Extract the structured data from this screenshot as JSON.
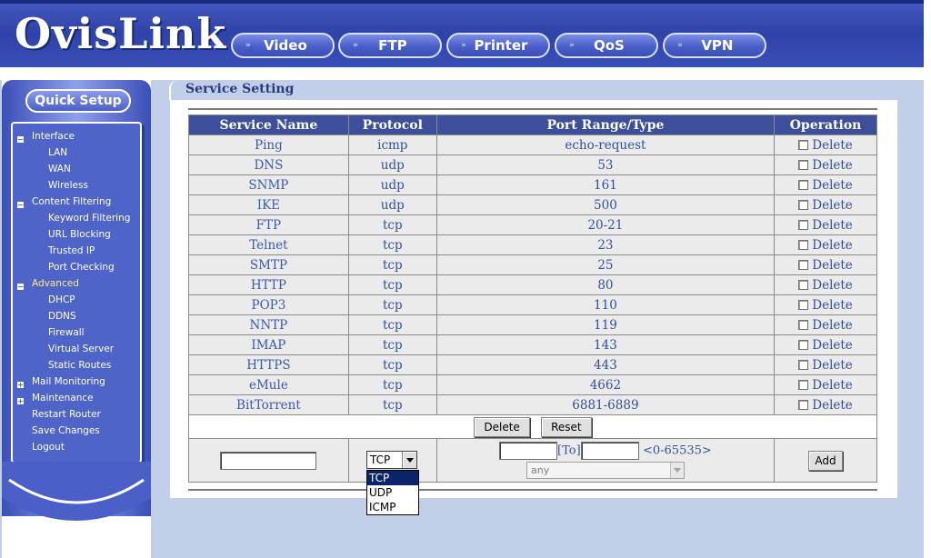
{
  "header": {
    "logo": "OvisLink",
    "nav": [
      {
        "label": "Video"
      },
      {
        "label": "FTP"
      },
      {
        "label": "Printer"
      },
      {
        "label": "QoS"
      },
      {
        "label": "VPN"
      }
    ],
    "nav_arrow": "»"
  },
  "sidebar": {
    "quick_setup": "Quick Setup",
    "menu": [
      {
        "label": "Interface",
        "level": "top",
        "expander": "−"
      },
      {
        "label": "LAN",
        "level": "sub"
      },
      {
        "label": "WAN",
        "level": "sub"
      },
      {
        "label": "Wireless",
        "level": "sub"
      },
      {
        "label": "Content Filtering",
        "level": "top",
        "expander": "−"
      },
      {
        "label": "Keyword Filtering",
        "level": "sub"
      },
      {
        "label": "URL Blocking",
        "level": "sub"
      },
      {
        "label": "Trusted IP",
        "level": "sub"
      },
      {
        "label": "Port Checking",
        "level": "sub"
      },
      {
        "label": "Advanced",
        "level": "top",
        "expander": "−",
        "active": true
      },
      {
        "label": "DHCP",
        "level": "sub"
      },
      {
        "label": "DDNS",
        "level": "sub"
      },
      {
        "label": "Firewall",
        "level": "sub"
      },
      {
        "label": "Virtual Server",
        "level": "sub"
      },
      {
        "label": "Static Routes",
        "level": "sub"
      },
      {
        "label": "Mail Monitoring",
        "level": "top",
        "expander": "+"
      },
      {
        "label": "Maintenance",
        "level": "top",
        "expander": "+"
      },
      {
        "label": "Restart Router",
        "level": "top"
      },
      {
        "label": "Save Changes",
        "level": "top"
      },
      {
        "label": "Logout",
        "level": "top"
      }
    ]
  },
  "page": {
    "tab_title": "Service Setting"
  },
  "table": {
    "headers": [
      "Service Name",
      "Protocol",
      "Port Range/Type",
      "Operation"
    ],
    "delete_label": "Delete",
    "rows": [
      {
        "name": "Ping",
        "protocol": "icmp",
        "port": "echo-request"
      },
      {
        "name": "DNS",
        "protocol": "udp",
        "port": "53"
      },
      {
        "name": "SNMP",
        "protocol": "udp",
        "port": "161"
      },
      {
        "name": "IKE",
        "protocol": "udp",
        "port": "500"
      },
      {
        "name": "FTP",
        "protocol": "tcp",
        "port": "20-21"
      },
      {
        "name": "Telnet",
        "protocol": "tcp",
        "port": "23"
      },
      {
        "name": "SMTP",
        "protocol": "tcp",
        "port": "25"
      },
      {
        "name": "HTTP",
        "protocol": "tcp",
        "port": "80"
      },
      {
        "name": "POP3",
        "protocol": "tcp",
        "port": "110"
      },
      {
        "name": "NNTP",
        "protocol": "tcp",
        "port": "119"
      },
      {
        "name": "IMAP",
        "protocol": "tcp",
        "port": "143"
      },
      {
        "name": "HTTPS",
        "protocol": "tcp",
        "port": "443"
      },
      {
        "name": "eMule",
        "protocol": "tcp",
        "port": "4662"
      },
      {
        "name": "BitTorrent",
        "protocol": "tcp",
        "port": "6881-6889"
      }
    ],
    "buttons": {
      "delete": "Delete",
      "reset": "Reset"
    }
  },
  "add_form": {
    "service_name_value": "",
    "protocol_selected": "TCP",
    "protocol_options": [
      "TCP",
      "UDP",
      "ICMP"
    ],
    "port_from_value": "",
    "to_label": "[To]",
    "port_to_value": "",
    "range_hint": "<0-65535>",
    "type_selected": "any",
    "add_button": "Add"
  }
}
